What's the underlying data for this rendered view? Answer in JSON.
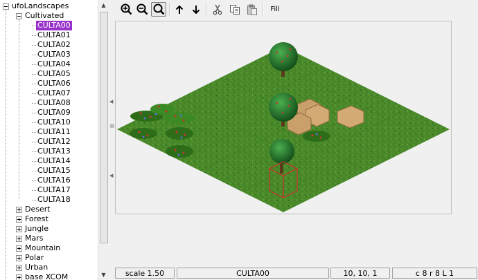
{
  "tree": {
    "root_label": "ufoLandscapes",
    "expanded_group_label": "Cultivated",
    "expanded_children": [
      "CULTA00",
      "CULTA01",
      "CULTA02",
      "CULTA03",
      "CULTA04",
      "CULTA05",
      "CULTA06",
      "CULTA07",
      "CULTA08",
      "CULTA09",
      "CULTA10",
      "CULTA11",
      "CULTA12",
      "CULTA13",
      "CULTA14",
      "CULTA15",
      "CULTA16",
      "CULTA17",
      "CULTA18"
    ],
    "selected_child": "CULTA00",
    "collapsed_groups": [
      "Desert",
      "Forest",
      "Jungle",
      "Mars",
      "Mountain",
      "Polar",
      "Urban",
      "base XCOM"
    ]
  },
  "toolbar": {
    "zoom_in_icon": "zoom-in-icon",
    "zoom_out_icon": "zoom-out-icon",
    "zoom_fit_icon": "zoom-fit-icon",
    "level_up_icon": "arrow-up-icon",
    "level_down_icon": "arrow-down-icon",
    "cut_icon": "scissors-icon",
    "copy_icon": "copy-icon",
    "paste_icon": "paste-icon",
    "fill_label": "Fill"
  },
  "status": {
    "scale": "scale 1.50",
    "map_name": "CULTA00",
    "cursor_pos": "10, 10, 1",
    "dimensions": "c 8  r 8  L 1"
  },
  "colors": {
    "grass": "#4a8a2a",
    "selection": "#9932cc",
    "cursor": "#c0392b"
  }
}
